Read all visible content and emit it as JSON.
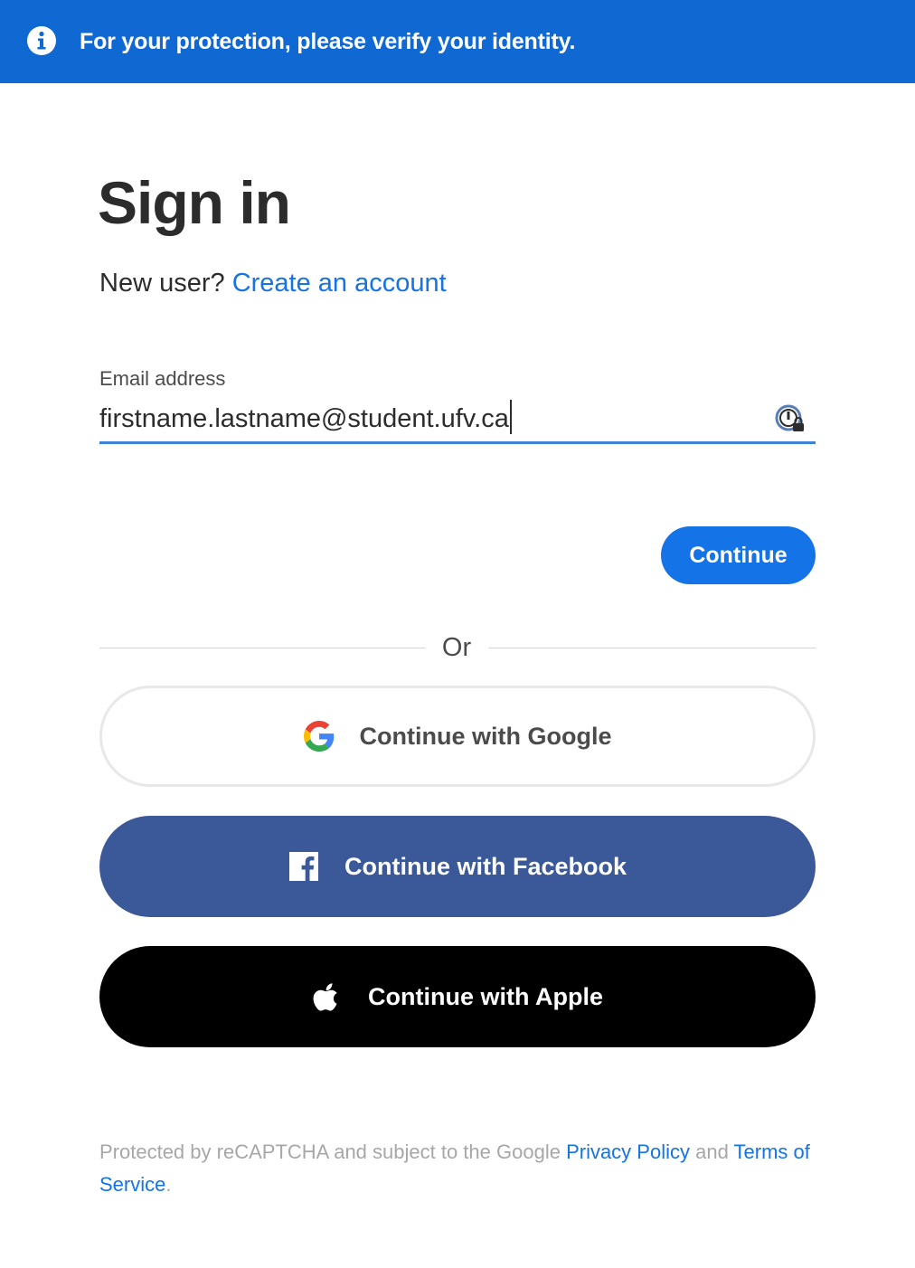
{
  "banner": {
    "icon": "info-icon",
    "text": "For your protection, please verify your identity.",
    "color": "#1068d2"
  },
  "page": {
    "title": "Sign in",
    "new_user_prompt": "New user?",
    "create_account_link": "Create an account"
  },
  "email": {
    "label": "Email address",
    "value": "firstname.lastname@student.ufv.ca",
    "trailing_icon": "password-manager-key-icon"
  },
  "actions": {
    "continue_label": "Continue",
    "accent": "#1473e6"
  },
  "divider": {
    "label": "Or"
  },
  "social": {
    "google": {
      "label": "Continue with Google",
      "icon": "google-g-icon"
    },
    "facebook": {
      "label": "Continue with Facebook",
      "icon": "facebook-f-icon",
      "color": "#3b5998"
    },
    "apple": {
      "label": "Continue with Apple",
      "icon": "apple-logo-icon",
      "color": "#000000"
    }
  },
  "footer": {
    "text_1": "Protected by reCAPTCHA and subject to the Google ",
    "privacy_link": "Privacy Policy",
    "text_2": " and ",
    "terms_link": "Terms of Service",
    "text_3": "."
  }
}
